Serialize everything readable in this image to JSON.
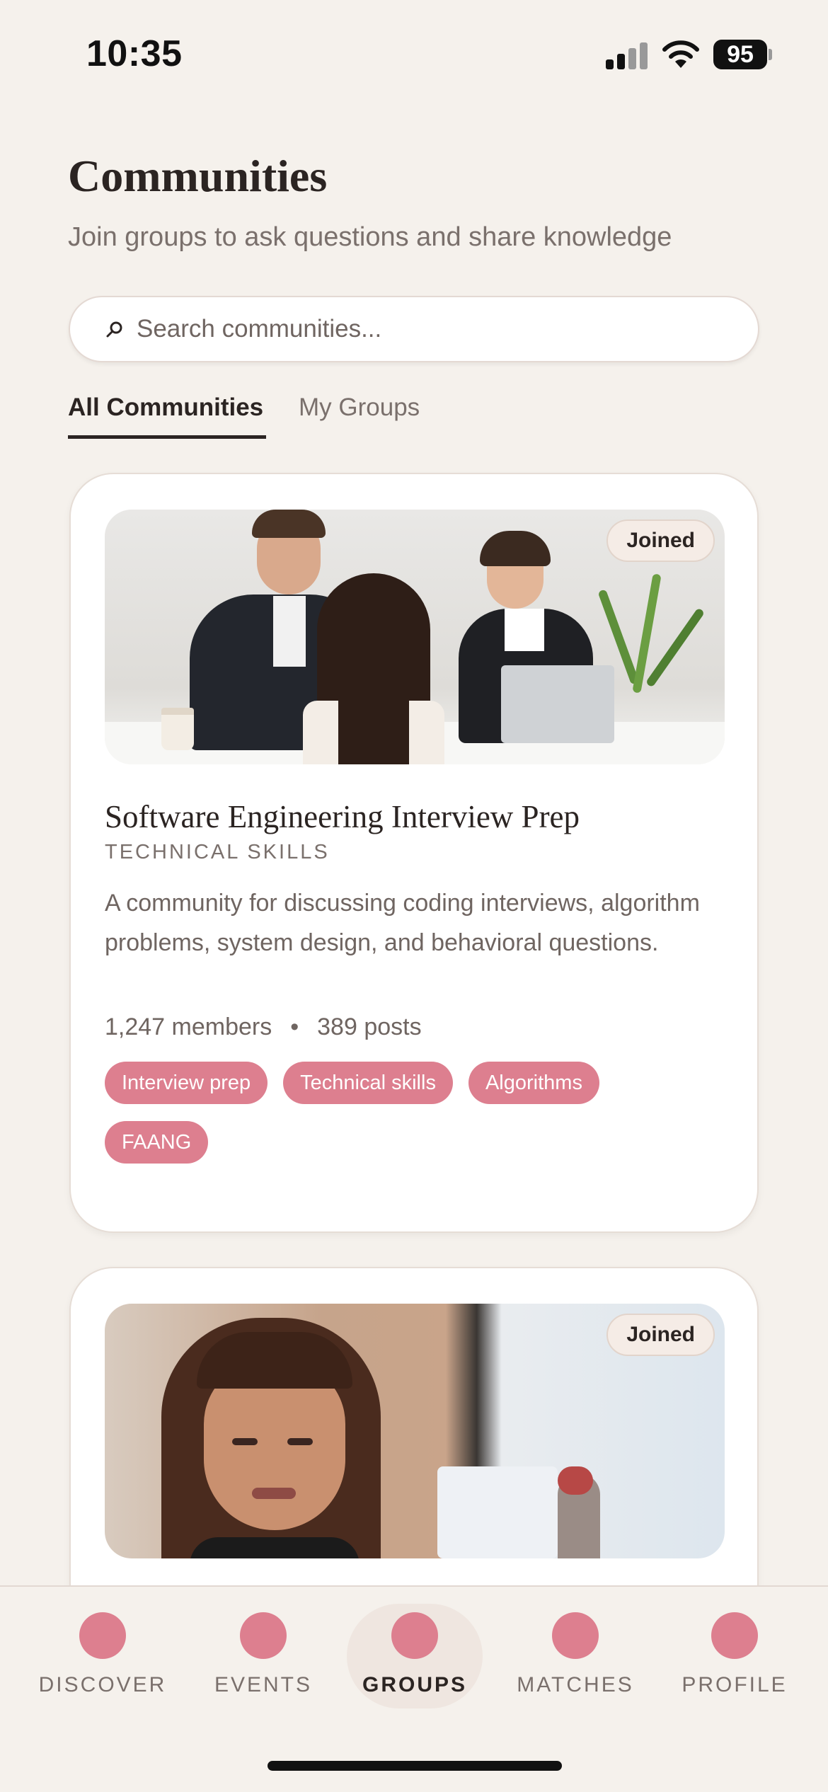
{
  "status_bar": {
    "time": "10:35",
    "battery": "95",
    "icons": [
      "signal-icon",
      "wifi-icon",
      "battery-icon"
    ]
  },
  "header": {
    "title": "Communities",
    "subtitle": "Join groups to ask questions and share knowledge"
  },
  "search": {
    "placeholder": "Search communities...",
    "icon": "search-icon"
  },
  "tabs": [
    {
      "label": "All Communities",
      "active": true
    },
    {
      "label": "My Groups",
      "active": false
    }
  ],
  "communities": [
    {
      "badge": "Joined",
      "title": "Software Engineering Interview Prep",
      "category": "TECHNICAL SKILLS",
      "description": "A community for discussing coding interviews, algorithm problems, system design, and behavioral questions.",
      "members": "1,247 members",
      "separator": "•",
      "posts": "389 posts",
      "tags": [
        "Interview prep",
        "Technical skills",
        "Algorithms",
        "FAANG"
      ]
    },
    {
      "badge": "Joined"
    }
  ],
  "bottom_nav": {
    "items": [
      {
        "label": "DISCOVER",
        "active": false
      },
      {
        "label": "EVENTS",
        "active": false
      },
      {
        "label": "GROUPS",
        "active": true
      },
      {
        "label": "MATCHES",
        "active": false
      },
      {
        "label": "PROFILE",
        "active": false
      }
    ]
  },
  "colors": {
    "background": "#f5f1ec",
    "accent": "#dd7f8f",
    "text": "#2b2422",
    "muted": "#7a706c"
  }
}
